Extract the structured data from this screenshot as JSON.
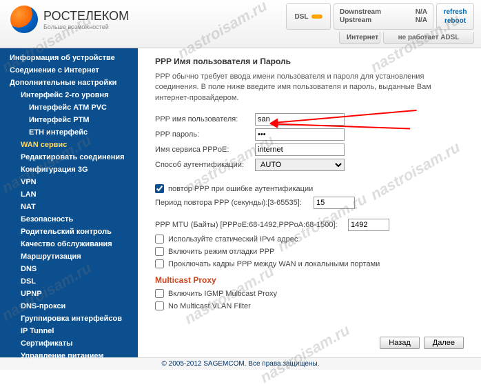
{
  "brand": {
    "name": "РОСТЕЛЕКОМ",
    "tag": "Больше возможностей"
  },
  "header": {
    "dsl": "DSL",
    "downstream_label": "Downstream",
    "downstream_val": "N/A",
    "upstream_label": "Upstream",
    "upstream_val": "N/A",
    "refresh": "refresh",
    "reboot": "reboot",
    "internet": "Интернет",
    "adsl_status": "не работает ADSL"
  },
  "sidebar": {
    "items": [
      "Информация об устройстве",
      "Соединение с Интернет",
      "Дополнительные настройки",
      "Интерфейс 2-го уровня",
      "Интерфейс ATM PVC",
      "Интерфейс PTM",
      "ETH интерфейс",
      "WAN сервис",
      "Редактировать соединения",
      "Конфигурация 3G",
      "VPN",
      "LAN",
      "NAT",
      "Безопасность",
      "Родительский контроль",
      "Качество обслуживания",
      "Маршрутизация",
      "DNS",
      "DSL",
      "UPNP",
      "DNS-прокси",
      "Группировка интерфейсов",
      "IP Tunnel",
      "Сертификаты",
      "Управление питанием"
    ]
  },
  "content": {
    "title": "PPP Имя пользователя и Пароль",
    "desc": "PPP обычно требует ввода имени пользователя и пароля для установления соединения. В поле ниже введите имя пользователя и пароль, выданные Вам интернет-провайдером.",
    "ppp_user_label": "PPP имя пользователя:",
    "ppp_user_value": "san",
    "ppp_pass_label": "PPP пароль:",
    "ppp_pass_value": "•••",
    "pppoe_service_label": "Имя сервиса PPPoE:",
    "pppoe_service_value": "internet",
    "auth_label": "Способ аутентификации:",
    "auth_value": "AUTO",
    "retry_checkbox": "повтор PPP при ошибке аутентификации",
    "retry_period_label": "Период повтора PPP (секунды):[3-65535]:",
    "retry_period_value": "15",
    "mtu_label": "PPP MTU (Байты) [PPPoE:68-1492,PPPoA:68-1500]:",
    "mtu_value": "1492",
    "static_ipv4": "Используйте статический IPv4 адрес",
    "debug_ppp": "Включить режим отладки PPP",
    "bridge_ppp": "Проключать кадры PPP между WAN и локальными портами",
    "multicast_title": "Multicast Proxy",
    "igmp": "Включить IGMP Multicast Proxy",
    "vlan_filter": "No Multicast VLAN Filter",
    "back": "Назад",
    "next": "Далее"
  },
  "footer": "© 2005-2012 SAGEMCOM. Все права защищены.",
  "watermark": "nastroisam.ru"
}
